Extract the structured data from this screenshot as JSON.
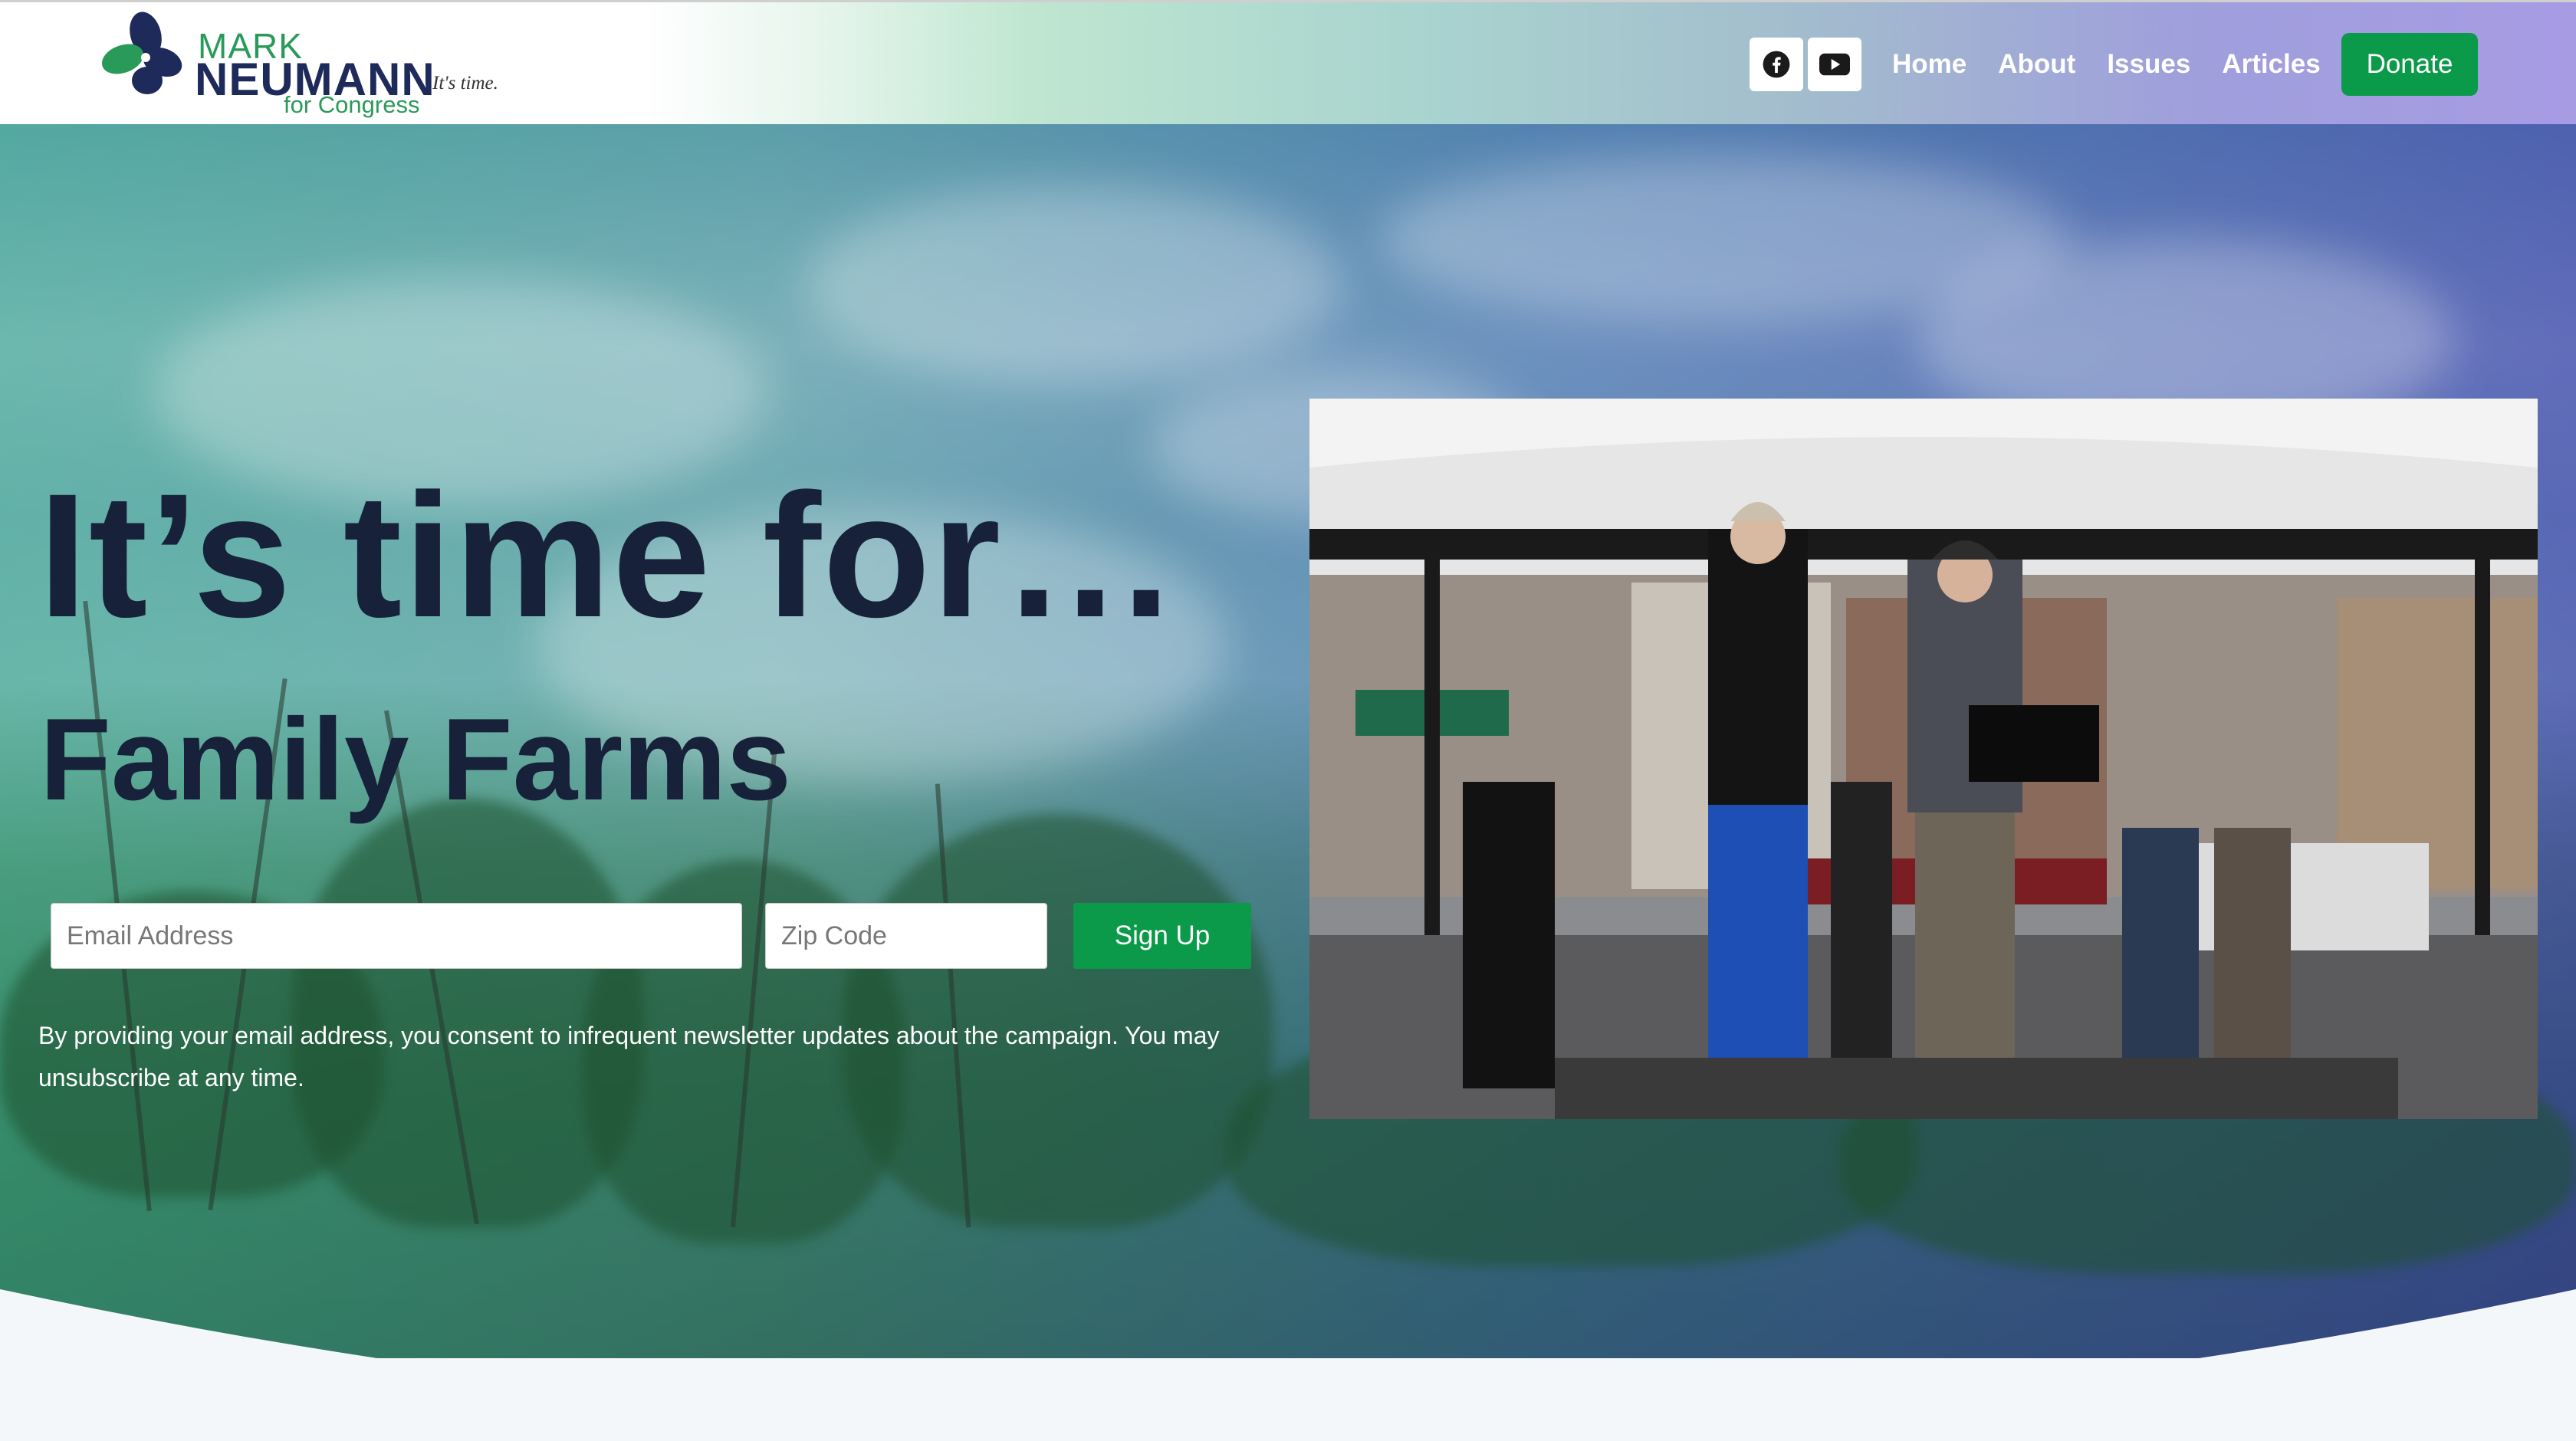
{
  "header": {
    "logo": {
      "first_name": "MARK",
      "last_name": "NEUMANN",
      "sub": "for Congress",
      "tagline": "It's time."
    },
    "social": [
      {
        "icon": "facebook-icon"
      },
      {
        "icon": "youtube-icon"
      }
    ],
    "nav": [
      "Home",
      "About",
      "Issues",
      "Articles"
    ],
    "donate_label": "Donate",
    "colors": {
      "accent": "#0b9a49",
      "navy": "#1d2a5a",
      "brand_green": "#2a9a5a"
    }
  },
  "hero": {
    "headline": "It’s time for…",
    "subhead": "Family Farms",
    "form": {
      "email_placeholder": "Email Address",
      "zip_placeholder": "Zip Code",
      "submit_label": "Sign Up"
    },
    "consent": "By providing your email address, you consent to infrequent newsletter updates about the campaign. You may unsubscribe at any time."
  }
}
